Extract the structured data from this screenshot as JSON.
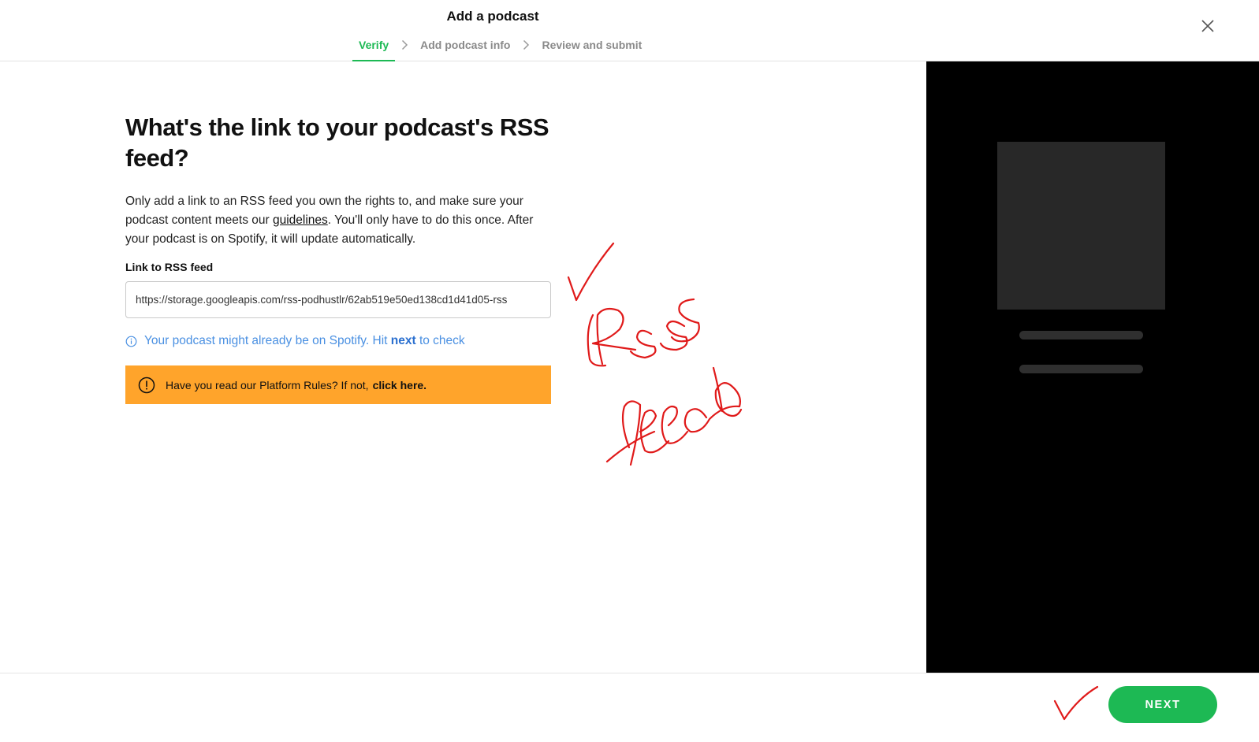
{
  "header": {
    "title": "Add a podcast",
    "steps": [
      {
        "label": "Verify",
        "state": "active"
      },
      {
        "label": "Add podcast info",
        "state": "inactive"
      },
      {
        "label": "Review and submit",
        "state": "inactive"
      }
    ],
    "close_icon": "close-icon"
  },
  "main": {
    "heading": "What's the link to your podcast's RSS feed?",
    "description": {
      "part1": "Only add a link to an RSS feed you own the rights to, and make sure your podcast content meets our ",
      "link": "guidelines",
      "part2": ". You'll only have to do this once. After your podcast is on Spotify, it will update automatically."
    },
    "field_label": "Link to RSS feed",
    "rss_value": "https://storage.googleapis.com/rss-podhustlr/62ab519e50ed138cd1d41d05-rss",
    "hint": {
      "prefix": "Your podcast might already be on Spotify. Hit ",
      "bold": "next",
      "suffix": " to check"
    },
    "warning": {
      "text": "Have you read our Platform Rules? If not,",
      "link": "click here."
    }
  },
  "footer": {
    "next_label": "NEXT"
  },
  "colors": {
    "accent": "#1db954",
    "warning": "#ffa42b",
    "info": "#4a90e2",
    "annotation": "#e01a1a",
    "preview_bg": "#000000"
  }
}
